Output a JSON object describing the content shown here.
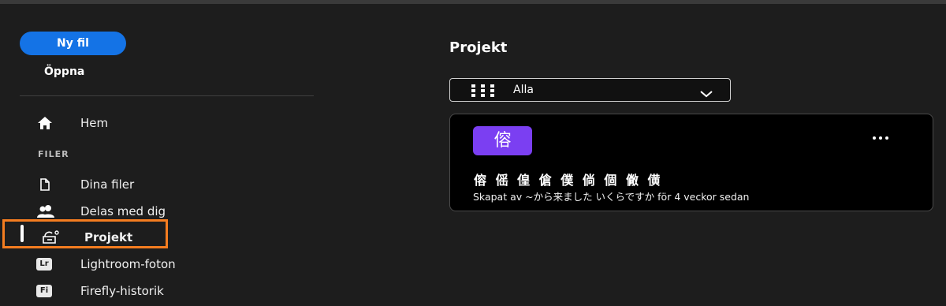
{
  "sidebar": {
    "new_file_label": "Ny fil",
    "open_label": "Öppna",
    "home_label": "Hem",
    "section_files": "FILER",
    "items": [
      {
        "label": "Dina filer",
        "icon": "document-icon"
      },
      {
        "label": "Delas med dig",
        "icon": "people-icon"
      },
      {
        "label": "Projekt",
        "icon": "project-icon",
        "active": true
      },
      {
        "label": "Lightroom-foton",
        "icon": "lightroom-icon",
        "badge": "Lr"
      },
      {
        "label": "Firefly-historik",
        "icon": "firefly-icon",
        "badge": "Fi"
      }
    ]
  },
  "main": {
    "title": "Projekt",
    "filter": {
      "value": "Alla"
    },
    "card": {
      "thumb_char": "傛",
      "title": "傛 傜 偟 傖 僕 倘 個 僘 僙",
      "meta": "Skapat av ~から来ました いくらですか för 4 veckor sedan"
    }
  },
  "colors": {
    "accent": "#1473e6",
    "highlight": "#f47d20",
    "thumb": "#7b3ff2",
    "background": "#1d1d1d"
  }
}
